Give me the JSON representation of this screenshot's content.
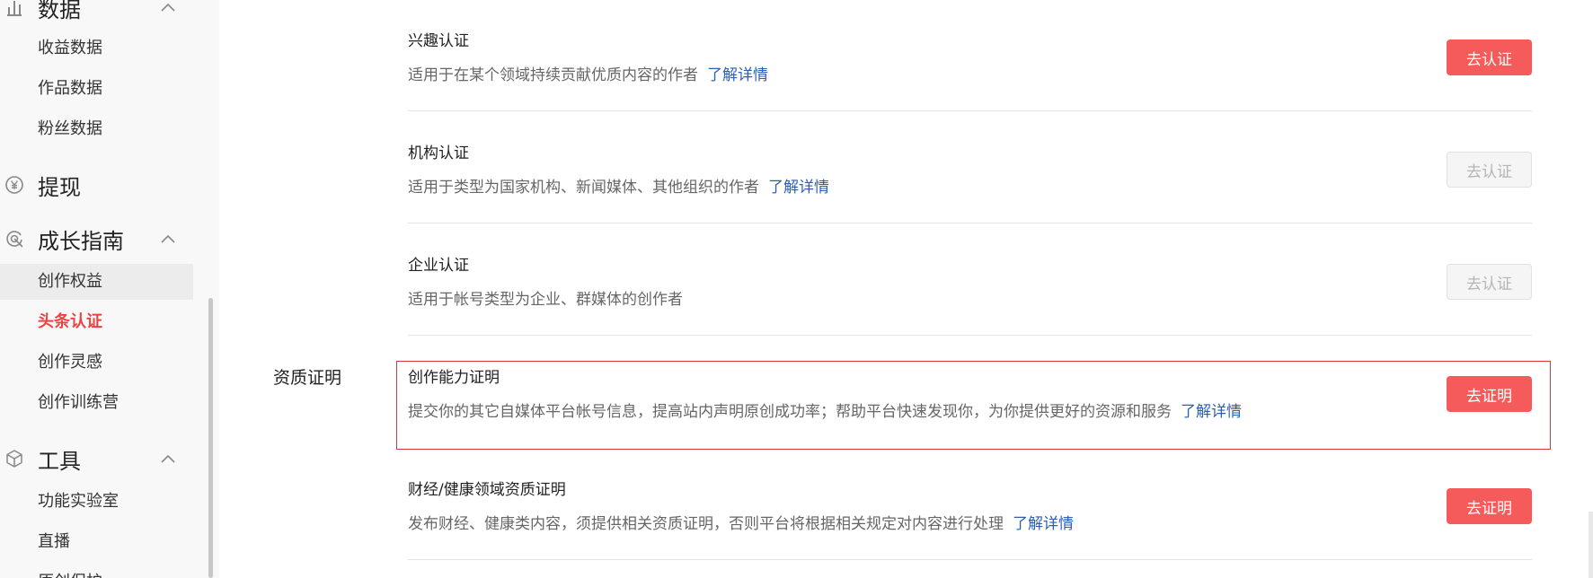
{
  "sidebar": {
    "sections": [
      {
        "title": "数据",
        "icon": "bar-chart-icon",
        "chevron": "chevron-up-icon"
      },
      {
        "title": "提现",
        "icon": "yen-circle-icon"
      },
      {
        "title": "成长指南",
        "icon": "growth-target-icon",
        "chevron": "chevron-up-icon"
      },
      {
        "title": "工具",
        "icon": "cube-icon",
        "chevron": "chevron-up-icon"
      }
    ],
    "data_items": [
      "收益数据",
      "作品数据",
      "粉丝数据"
    ],
    "growth_items": [
      "创作权益",
      "头条认证",
      "创作灵感",
      "创作训练营"
    ],
    "tool_items": [
      "功能实验室",
      "直播",
      "原创保护"
    ],
    "active_item": "头条认证",
    "accent_color": "#f04142"
  },
  "main": {
    "group_label": "资质证明",
    "rows": [
      {
        "title": "兴趣认证",
        "desc": "适用于在某个领域持续贡献优质内容的作者",
        "link": "了解详情",
        "button": "去认证",
        "enabled": true
      },
      {
        "title": "机构认证",
        "desc": "适用于类型为国家机构、新闻媒体、其他组织的作者",
        "link": "了解详情",
        "button": "去认证",
        "enabled": false
      },
      {
        "title": "企业认证",
        "desc": "适用于帐号类型为企业、群媒体的创作者",
        "link": "",
        "button": "去认证",
        "enabled": false
      },
      {
        "title": "创作能力证明",
        "desc": "提交你的其它自媒体平台帐号信息，提高站内声明原创成功率；帮助平台快速发现你，为你提供更好的资源和服务",
        "link": "了解详情",
        "button": "去证明",
        "enabled": true
      },
      {
        "title": "财经/健康领域资质证明",
        "desc": "发布财经、健康类内容，须提供相关资质证明，否则平台将根据相关规定对内容进行处理",
        "link": "了解详情",
        "button": "去证明",
        "enabled": true
      }
    ],
    "button_color": "#f65b5b",
    "link_color": "#2b5fb3"
  }
}
